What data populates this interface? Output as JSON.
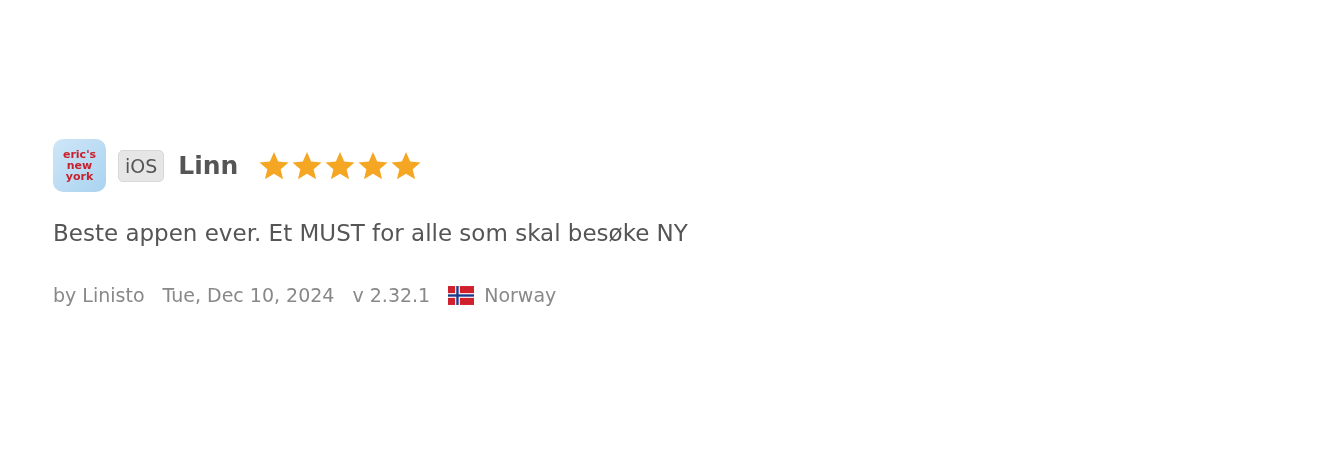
{
  "review": {
    "app_icon_text": "eric's new york",
    "platform": "iOS",
    "reviewer": "Linn",
    "stars": 5,
    "text": "Beste appen ever. Et MUST for alle som skal besøke NY",
    "author": "by Linisto",
    "date": "Tue, Dec 10, 2024",
    "version": "v 2.32.1",
    "country": "Norway"
  }
}
